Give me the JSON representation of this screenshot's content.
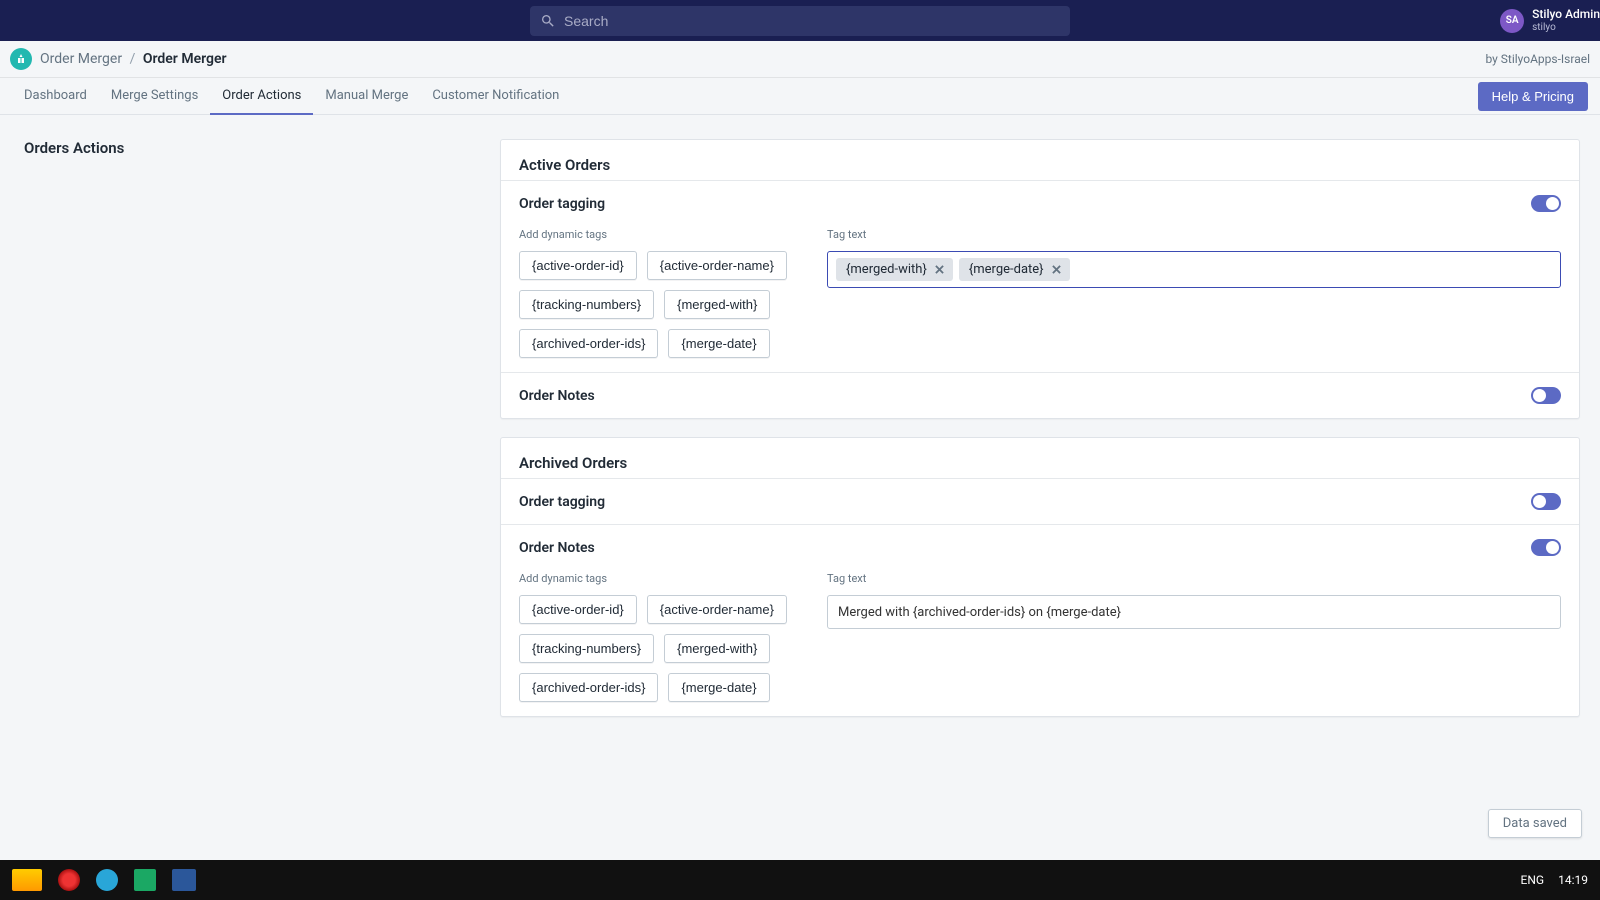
{
  "topbar": {
    "search_placeholder": "Search",
    "avatar_initials": "SA",
    "user_name": "Stilyo Admin",
    "user_sub": "stilyo"
  },
  "breadcrumb": {
    "app": "Order Merger",
    "current": "Order Merger",
    "byline": "by StilyoApps-Israel"
  },
  "tabs": {
    "items": [
      "Dashboard",
      "Merge Settings",
      "Order Actions",
      "Manual Merge",
      "Customer Notification"
    ],
    "help_label": "Help & Pricing"
  },
  "left": {
    "title": "Orders Actions"
  },
  "active": {
    "heading": "Active Orders",
    "tagging": {
      "title": "Order tagging",
      "add_label": "Add dynamic tags",
      "buttons": [
        "{active-order-id}",
        "{active-order-name}",
        "{tracking-numbers}",
        "{merged-with}",
        "{archived-order-ids}",
        "{merge-date}"
      ],
      "field_label": "Tag text",
      "chips": [
        "{merged-with}",
        "{merge-date}"
      ]
    },
    "notes": {
      "title": "Order Notes"
    }
  },
  "archived": {
    "heading": "Archived Orders",
    "tagging": {
      "title": "Order tagging"
    },
    "notes": {
      "title": "Order Notes",
      "add_label": "Add dynamic tags",
      "buttons": [
        "{active-order-id}",
        "{active-order-name}",
        "{tracking-numbers}",
        "{merged-with}",
        "{archived-order-ids}",
        "{merge-date}"
      ],
      "field_label": "Tag text",
      "field_value": "Merged with {archived-order-ids} on {merge-date}"
    }
  },
  "toast": "Data saved",
  "tray": {
    "lang": "ENG",
    "time": "14:19"
  }
}
